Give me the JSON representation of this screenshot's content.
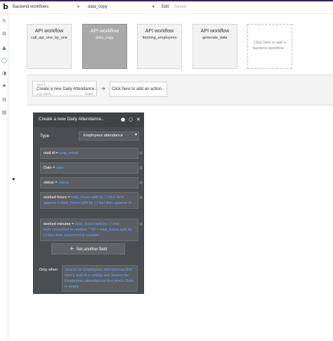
{
  "topbar": {
    "workflows_dropdown": "Backend workflows",
    "workflow_dropdown": "data_copy",
    "edit_label": "Edit",
    "saved_label": "Saved",
    "logo": "b"
  },
  "sidebar": {
    "icons": [
      "pencil-icon",
      "bug-icon",
      "workflow-icon",
      "database-icon",
      "palette-icon",
      "plugins-icon",
      "settings-icon",
      "logs-icon"
    ],
    "active_icon": "workflow-icon"
  },
  "cards": [
    {
      "title": "API workflow",
      "name": "call_api_one_by_one",
      "selected": false
    },
    {
      "title": "API workflow",
      "name": "data_copy",
      "selected": true
    },
    {
      "title": "API workflow",
      "name": "fetching_employees",
      "selected": false
    },
    {
      "title": "API workflow",
      "name": "generate_date",
      "selected": false
    }
  ],
  "add_card": {
    "text": "Click here to add a backend workflow..."
  },
  "steps": {
    "step1": {
      "number": "Step 1",
      "title": "Create a new Daily Attendance...",
      "only_when": "only when...",
      "delete": "delete"
    },
    "add_action": "Click here to add an action..."
  },
  "editor": {
    "title": "Create a new Daily Attendance..",
    "type_label": "Type",
    "type_value": "Employees attendance",
    "fields": [
      {
        "label": "mail id =",
        "expr": "emp_email"
      },
      {
        "label": "Date =",
        "expr": "date"
      },
      {
        "label": "status =",
        "expr": "status"
      },
      {
        "label": "worked hours =",
        "expr": "total_hours:split by (:):first item append h  total_hours:split by (:):last item append m"
      },
      {
        "label": "worked minutes =",
        "expr": "total_hours:split by (:):first item:converted to number * 60 + total_hours:split by (:):last item converted to number"
      }
    ],
    "set_another_field": "Set another field",
    "only_when_label": "Only when",
    "only_when_expr": "Search for Employees attendances:first item's mail id is empty and Search for Employees attendances:first item's Date is empty"
  }
}
